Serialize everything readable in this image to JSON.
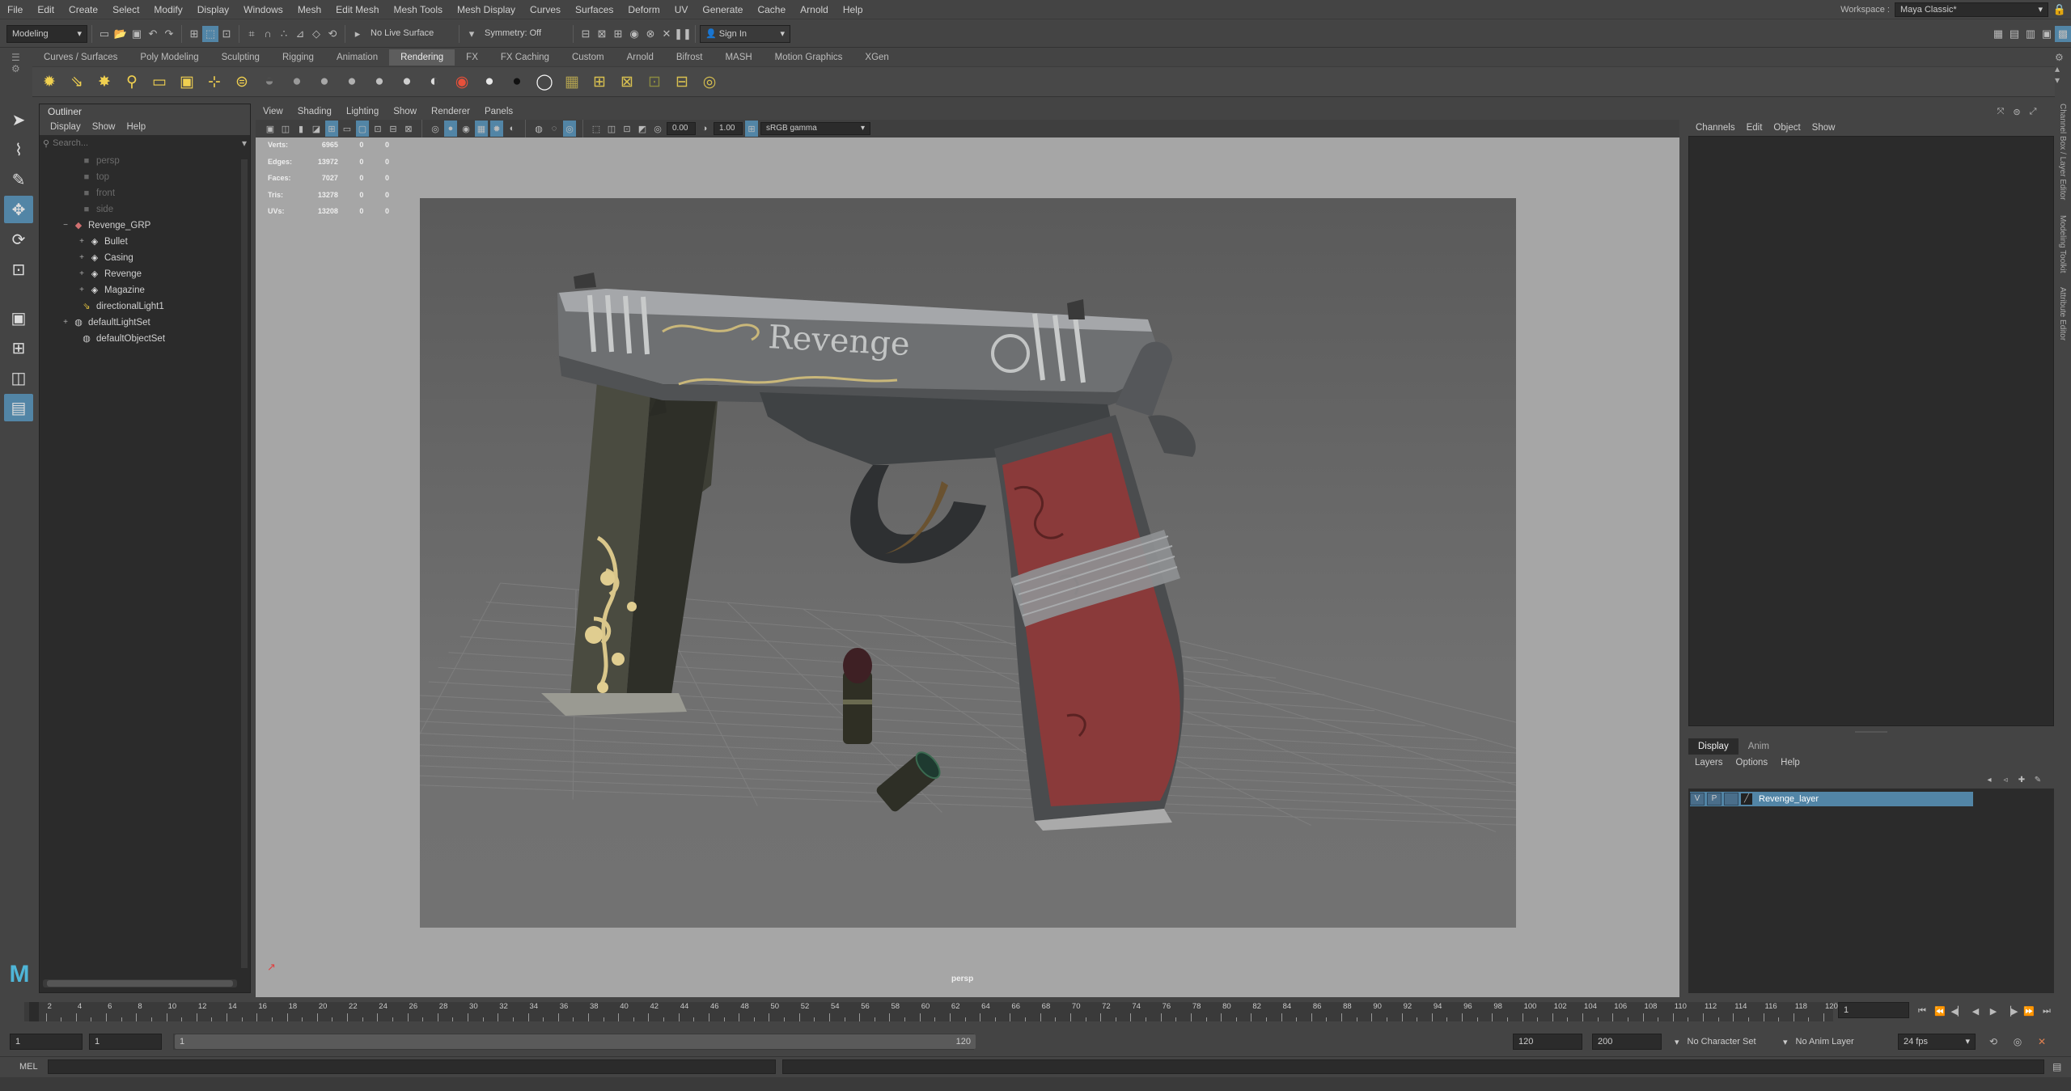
{
  "menubar": {
    "items": [
      "File",
      "Edit",
      "Create",
      "Select",
      "Modify",
      "Display",
      "Windows",
      "Mesh",
      "Edit Mesh",
      "Mesh Tools",
      "Mesh Display",
      "Curves",
      "Surfaces",
      "Deform",
      "UV",
      "Generate",
      "Cache",
      "Arnold",
      "Help"
    ],
    "workspace_label": "Workspace :",
    "workspace_value": "Maya Classic*"
  },
  "statusline": {
    "mode": "Modeling",
    "live_surface": "No Live Surface",
    "symmetry": "Symmetry: Off",
    "sign_in": "Sign In"
  },
  "shelf": {
    "tabs": [
      "Curves / Surfaces",
      "Poly Modeling",
      "Sculpting",
      "Rigging",
      "Animation",
      "Rendering",
      "FX",
      "FX Caching",
      "Custom",
      "Arnold",
      "Bifrost",
      "MASH",
      "Motion Graphics",
      "XGen"
    ],
    "active_tab": "Rendering"
  },
  "outliner": {
    "title": "Outliner",
    "menu": [
      "Display",
      "Show",
      "Help"
    ],
    "search_placeholder": "Search...",
    "items": [
      {
        "label": "persp",
        "icon": "camera-icon",
        "dim": true,
        "indent": 1
      },
      {
        "label": "top",
        "icon": "camera-icon",
        "dim": true,
        "indent": 1
      },
      {
        "label": "front",
        "icon": "camera-icon",
        "dim": true,
        "indent": 1
      },
      {
        "label": "side",
        "icon": "camera-icon",
        "dim": true,
        "indent": 1
      },
      {
        "label": "Revenge_GRP",
        "icon": "group-icon",
        "dim": false,
        "indent": 0,
        "expander": "−"
      },
      {
        "label": "Bullet",
        "icon": "mesh-icon",
        "dim": false,
        "indent": 2,
        "expander": "+"
      },
      {
        "label": "Casing",
        "icon": "mesh-icon",
        "dim": false,
        "indent": 2,
        "expander": "+"
      },
      {
        "label": "Revenge",
        "icon": "mesh-icon",
        "dim": false,
        "indent": 2,
        "expander": "+"
      },
      {
        "label": "Magazine",
        "icon": "mesh-icon",
        "dim": false,
        "indent": 2,
        "expander": "+"
      },
      {
        "label": "directionalLight1",
        "icon": "light-icon",
        "dim": false,
        "indent": 1
      },
      {
        "label": "defaultLightSet",
        "icon": "set-icon",
        "dim": false,
        "indent": 0,
        "expander": "+"
      },
      {
        "label": "defaultObjectSet",
        "icon": "set-icon",
        "dim": false,
        "indent": 1
      }
    ]
  },
  "viewport": {
    "menu": [
      "View",
      "Shading",
      "Lighting",
      "Show",
      "Renderer",
      "Panels"
    ],
    "exposure": "0.00",
    "gamma": "1.00",
    "color_space": "sRGB gamma",
    "camera_label": "persp",
    "hud": [
      {
        "label": "Verts:",
        "v1": "6965",
        "v2": "0",
        "v3": "0"
      },
      {
        "label": "Edges:",
        "v1": "13972",
        "v2": "0",
        "v3": "0"
      },
      {
        "label": "Faces:",
        "v1": "7027",
        "v2": "0",
        "v3": "0"
      },
      {
        "label": "Tris:",
        "v1": "13278",
        "v2": "0",
        "v3": "0"
      },
      {
        "label": "UVs:",
        "v1": "13208",
        "v2": "0",
        "v3": "0"
      }
    ],
    "engraving_text": "Revenge"
  },
  "channel_box": {
    "menu": [
      "Channels",
      "Edit",
      "Object",
      "Show"
    ],
    "side_tabs": [
      "Channel Box / Layer Editor",
      "Modeling Toolkit",
      "Attribute Editor"
    ]
  },
  "layer_editor": {
    "tabs": [
      "Display",
      "Anim"
    ],
    "menu": [
      "Layers",
      "Options",
      "Help"
    ],
    "layer": {
      "v": "V",
      "p": "P",
      "name": "Revenge_layer"
    }
  },
  "timeslider": {
    "ticks": [
      "1",
      "2",
      "4",
      "6",
      "8",
      "10",
      "12",
      "14",
      "16",
      "18",
      "20",
      "22",
      "24",
      "26",
      "28",
      "30",
      "32",
      "34",
      "36",
      "38",
      "40",
      "42",
      "44",
      "46",
      "48",
      "50",
      "52",
      "54",
      "56",
      "58",
      "60",
      "62",
      "64",
      "66",
      "68",
      "70",
      "72",
      "74",
      "76",
      "78",
      "80",
      "82",
      "84",
      "86",
      "88",
      "90",
      "92",
      "94",
      "96",
      "98",
      "100",
      "102",
      "104",
      "106",
      "108",
      "110",
      "112",
      "114",
      "116",
      "118",
      "120"
    ],
    "current_frame": "1"
  },
  "range": {
    "start": "1",
    "playback_start": "1",
    "slider_start": "1",
    "slider_end": "120",
    "playback_end": "120",
    "end": "200",
    "character_set": "No Character Set",
    "anim_layer": "No Anim Layer",
    "fps": "24 fps"
  },
  "command": {
    "label": "MEL"
  },
  "colors": {
    "accent": "#5285a6",
    "layer_highlight": "#5285a6"
  }
}
